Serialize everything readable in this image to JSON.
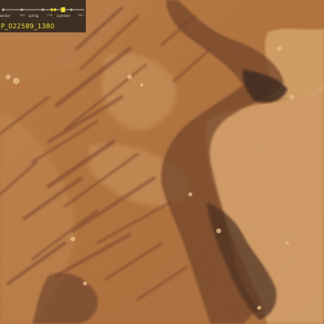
{
  "overlay": {
    "timeline": {
      "seasons": [
        {
          "label": "winter"
        },
        {
          "label": "spring"
        },
        {
          "label": "summer"
        }
      ],
      "ls_labels": [
        "180",
        "270",
        "360"
      ],
      "current_marker_fraction": 0.7,
      "accent_color": "#f2e232"
    },
    "image_id": "P_022589_1380"
  },
  "scene": {
    "subject": "eroded slope with dark downslope streaks on reddish-brown terrain",
    "colors": {
      "base": "#b5763d",
      "dark_rock": "#4a2a1c",
      "light_ridge": "#e4b27a",
      "streak": "#6e3a20"
    }
  }
}
